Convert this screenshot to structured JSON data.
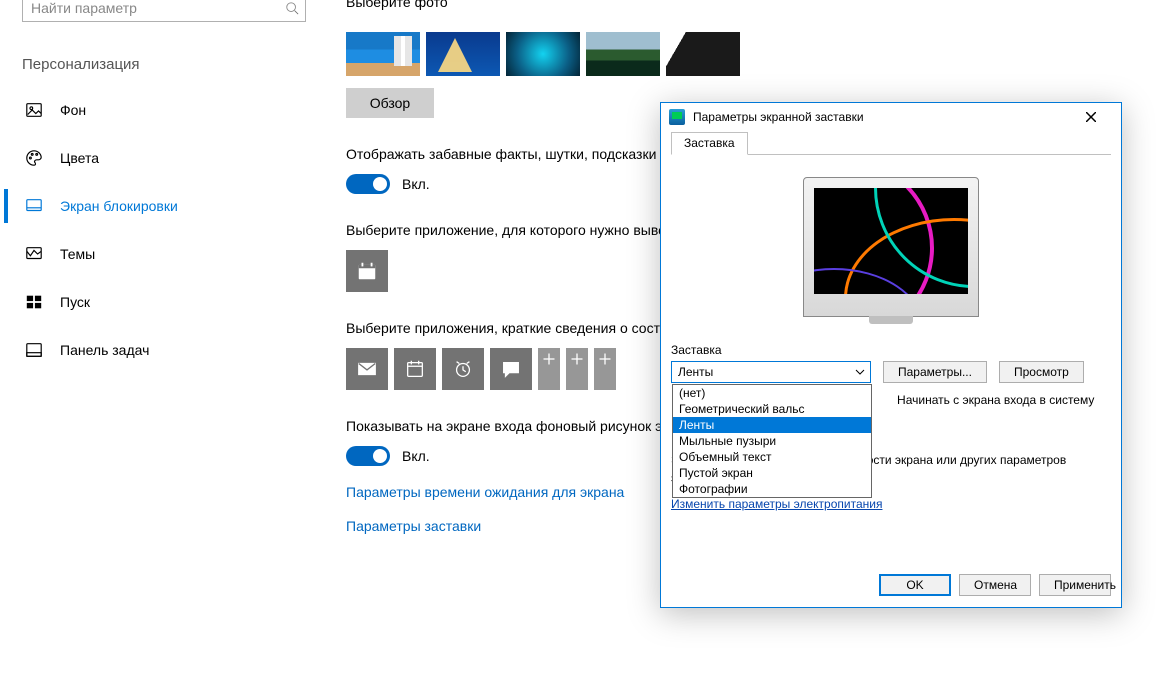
{
  "search": {
    "placeholder": "Найти параметр"
  },
  "section_title": "Персонализация",
  "nav": [
    {
      "key": "background",
      "label": "Фон"
    },
    {
      "key": "colors",
      "label": "Цвета"
    },
    {
      "key": "lockscreen",
      "label": "Экран блокировки",
      "selected": true
    },
    {
      "key": "themes",
      "label": "Темы"
    },
    {
      "key": "start",
      "label": "Пуск"
    },
    {
      "key": "taskbar",
      "label": "Панель задач"
    }
  ],
  "main": {
    "choose_photo_label": "Выберите фото",
    "browse_label": "Обзор",
    "fun_facts_text": "Отображать забавные факты, шутки, подсказки и другую информацию на экране блокировки",
    "toggle_on_label": "Вкл.",
    "choose_detailed_app": "Выберите приложение, для которого нужно выводить подробные сведения о состоянии",
    "choose_quick_apps": "Выберите приложения, краткие сведения о состоянии которых будут отображаться",
    "show_bg_on_signin": "Показывать на экране входа фоновый рисунок экрана блокировки",
    "timeout_link": "Параметры времени ожидания для экрана",
    "screensaver_link": "Параметры заставки"
  },
  "dialog": {
    "title": "Параметры экранной заставки",
    "tab": "Заставка",
    "group_label": "Заставка",
    "selected": "Ленты",
    "options": [
      "(нет)",
      "Геометрический вальс",
      "Ленты",
      "Мыльные пузыри",
      "Объемный текст",
      "Пустой экран",
      "Фотографии"
    ],
    "settings_btn": "Параметры...",
    "preview_btn": "Просмотр",
    "wait_hint": "Начинать с экрана входа в систему",
    "power_text": "Энергосбережение: изменение яркости экрана или других параметров электропитания.",
    "power_link": "Изменить параметры электропитания",
    "ok": "OK",
    "cancel": "Отмена",
    "apply": "Применить"
  }
}
